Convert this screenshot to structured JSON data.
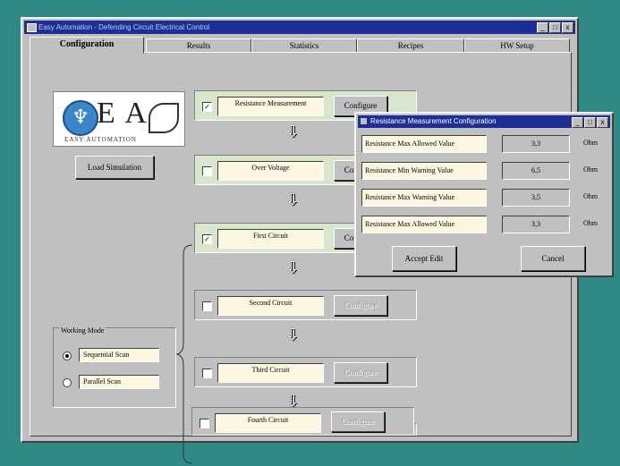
{
  "window": {
    "title": "Easy Automation - Defending Circuit Electrical Control",
    "min": "_",
    "max": "□",
    "close": "x"
  },
  "tabs": [
    {
      "label": "Configuration",
      "active": true
    },
    {
      "label": "Results"
    },
    {
      "label": "Statistics"
    },
    {
      "label": "Recipes"
    },
    {
      "label": "HW Setup"
    }
  ],
  "logo": {
    "letters": "E A",
    "tagline": "EASY AUTOMATION"
  },
  "load_simulation_label": "Load Simulation",
  "circuits": [
    {
      "name": "Resistance Measurement",
      "checked": true,
      "configure": "Configure",
      "enabled": true
    },
    {
      "name": "Over Voltage",
      "checked": false,
      "configure": "Configure",
      "enabled": true
    },
    {
      "name": "First Circuit",
      "checked": true,
      "configure": "Configure",
      "enabled": true
    },
    {
      "name": "Second Circuit",
      "checked": false,
      "configure": "Configure",
      "enabled": false
    },
    {
      "name": "Third Circuit",
      "checked": false,
      "configure": "Configure",
      "enabled": false
    },
    {
      "name": "Fourth Circuit",
      "checked": false,
      "configure": "Configure",
      "enabled": false
    }
  ],
  "working_mode": {
    "title": "Working Mode",
    "options": [
      {
        "label": "Sequential Scan",
        "selected": true
      },
      {
        "label": "Parallel Scan",
        "selected": false
      }
    ]
  },
  "dialog": {
    "title": "Resistance Measurement Configuration",
    "rows": [
      {
        "label": "Resistance Max Allowed Value",
        "value": "3,3",
        "unit": "Ohm"
      },
      {
        "label": "Resistance Min Warning Value",
        "value": "6,5",
        "unit": "Ohm"
      },
      {
        "label": "Resistance Max Warning Value",
        "value": "3,5",
        "unit": "Ohm"
      },
      {
        "label": "Resistance Max Allowed Value",
        "value": "3,3",
        "unit": "Ohm"
      }
    ],
    "accept_label": "Accept Edit",
    "cancel_label": "Cancel"
  },
  "colors": {
    "titlebar": "#1c2f96",
    "active_row": "#d7e6cc",
    "field": "#fdf7e2",
    "desktop": "#2f8a86"
  }
}
